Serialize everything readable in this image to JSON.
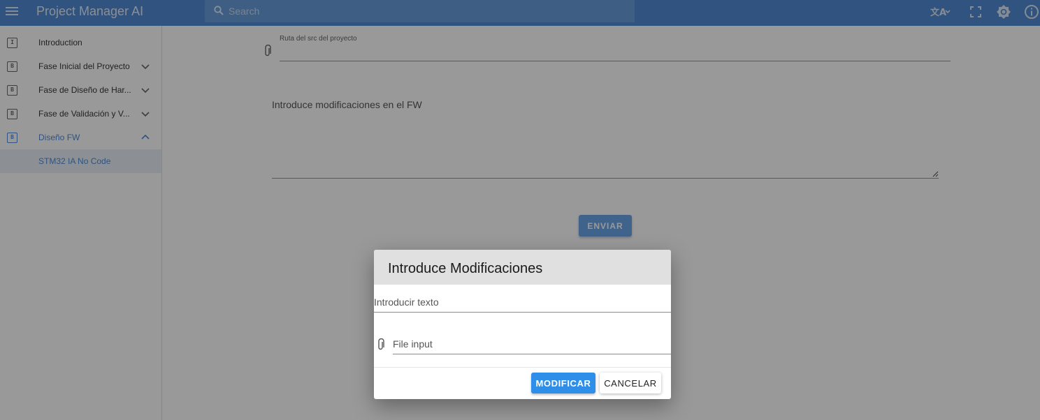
{
  "app": {
    "title": "Project Manager AI",
    "search_placeholder": "Search"
  },
  "topbar_icons": [
    "menu-icon",
    "translate-icon",
    "fullscreen-icon",
    "brightness-icon",
    "info-icon"
  ],
  "sidebar": {
    "items": [
      {
        "badge": "I",
        "label": "Introduction"
      },
      {
        "badge": "B",
        "label": "Fase Inicial del Proyecto"
      },
      {
        "badge": "B",
        "label": "Fase de Diseño de Har..."
      },
      {
        "badge": "B",
        "label": "Fase de Validación y V..."
      },
      {
        "badge": "B",
        "label": "Diseño FW"
      }
    ],
    "sub_item": {
      "label": "STM32 IA No Code"
    }
  },
  "main": {
    "src_label": "Ruta del src del proyecto",
    "fw_label": "Introduce modificaciones en el FW",
    "send_label": "ENVIAR"
  },
  "dialog": {
    "title": "Introduce Modificaciones",
    "text_placeholder": "Introducir texto",
    "file_placeholder": "File input",
    "modify_label": "MODIFICAR",
    "cancel_label": "CANCELAR"
  },
  "colors": {
    "appbar": "#3f7fcf",
    "accent": "#3a7fd2",
    "primary_button": "#2f8fe8"
  }
}
